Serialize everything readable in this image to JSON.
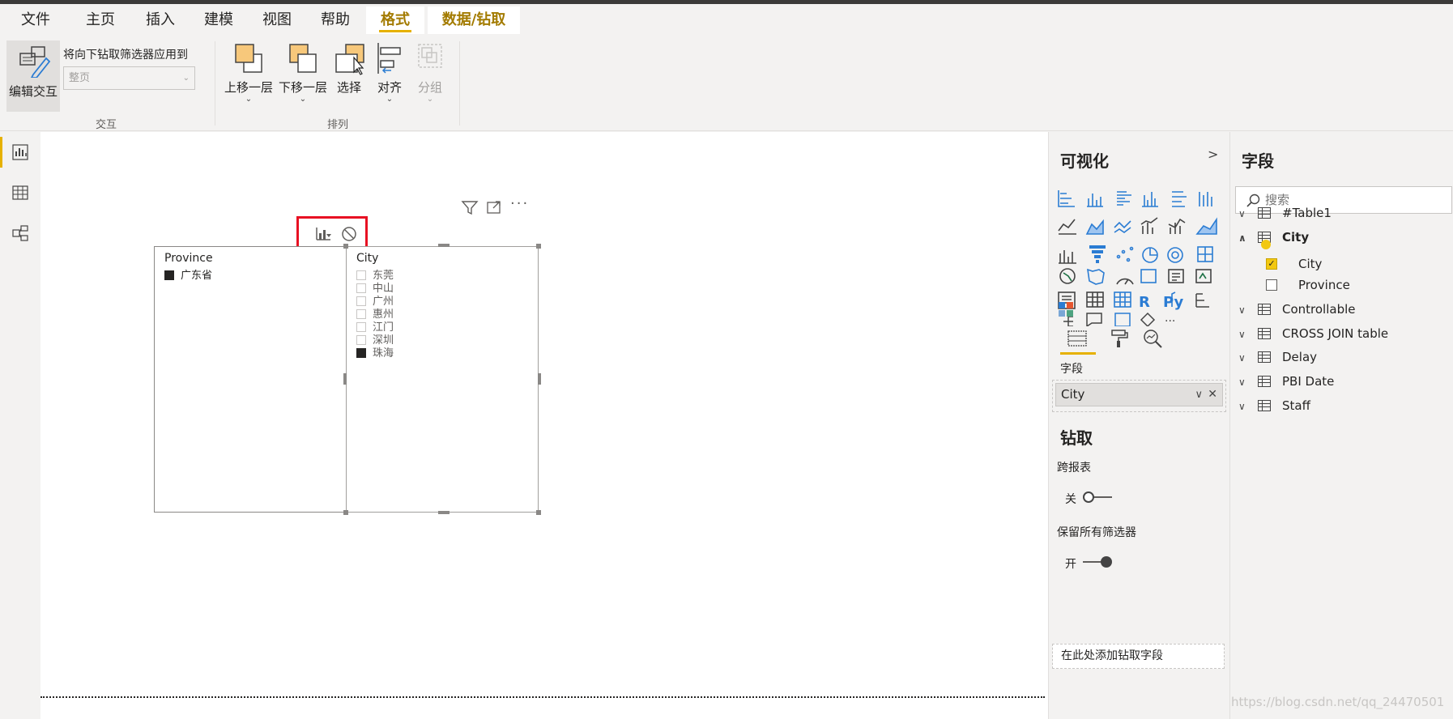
{
  "tabs": [
    {
      "label": "文件"
    },
    {
      "label": "主页"
    },
    {
      "label": "插入"
    },
    {
      "label": "建模"
    },
    {
      "label": "视图"
    },
    {
      "label": "帮助"
    },
    {
      "label": "格式"
    },
    {
      "label": "数据/钻取"
    }
  ],
  "ribbon": {
    "edit_interactions": "编辑交互",
    "drill_filter_label": "将向下钻取筛选器应用到",
    "drill_filter_value": "整页",
    "group_interact": "交互",
    "bring_forward": "上移一层",
    "send_backward": "下移一层",
    "select": "选择",
    "align": "对齐",
    "group": "分组",
    "group_arrange": "排列"
  },
  "slicers": {
    "province": {
      "title": "Province",
      "items": [
        {
          "label": "广东省",
          "checked": true
        }
      ]
    },
    "city": {
      "title": "City",
      "items": [
        {
          "label": "东莞",
          "checked": false
        },
        {
          "label": "中山",
          "checked": false
        },
        {
          "label": "广州",
          "checked": false
        },
        {
          "label": "惠州",
          "checked": false
        },
        {
          "label": "江门",
          "checked": false
        },
        {
          "label": "深圳",
          "checked": false
        },
        {
          "label": "珠海",
          "checked": true
        }
      ]
    }
  },
  "viz_panel": {
    "title": "可视化",
    "fields_label": "字段",
    "field_well_value": "City",
    "drill_title": "钻取",
    "cross_report": "跨报表",
    "cross_report_state": "关",
    "keep_filters": "保留所有筛选器",
    "keep_filters_state": "开",
    "add_drill_field": "在此处添加钻取字段"
  },
  "fields_panel": {
    "title": "字段",
    "search_placeholder": "搜索",
    "tables": [
      {
        "name": "#Table1",
        "expanded": false
      },
      {
        "name": "City",
        "expanded": true,
        "fields": [
          {
            "name": "City",
            "checked": true
          },
          {
            "name": "Province",
            "checked": false
          }
        ]
      },
      {
        "name": "Controllable",
        "expanded": false
      },
      {
        "name": "CROSS JOIN table",
        "expanded": false
      },
      {
        "name": "Delay",
        "expanded": false
      },
      {
        "name": "PBI Date",
        "expanded": false
      },
      {
        "name": "Staff",
        "expanded": false
      }
    ]
  },
  "watermark": "https://blog.csdn.net/qq_24470501",
  "colors": {
    "accent": "#e6b100",
    "highlight_box": "#e81123"
  }
}
